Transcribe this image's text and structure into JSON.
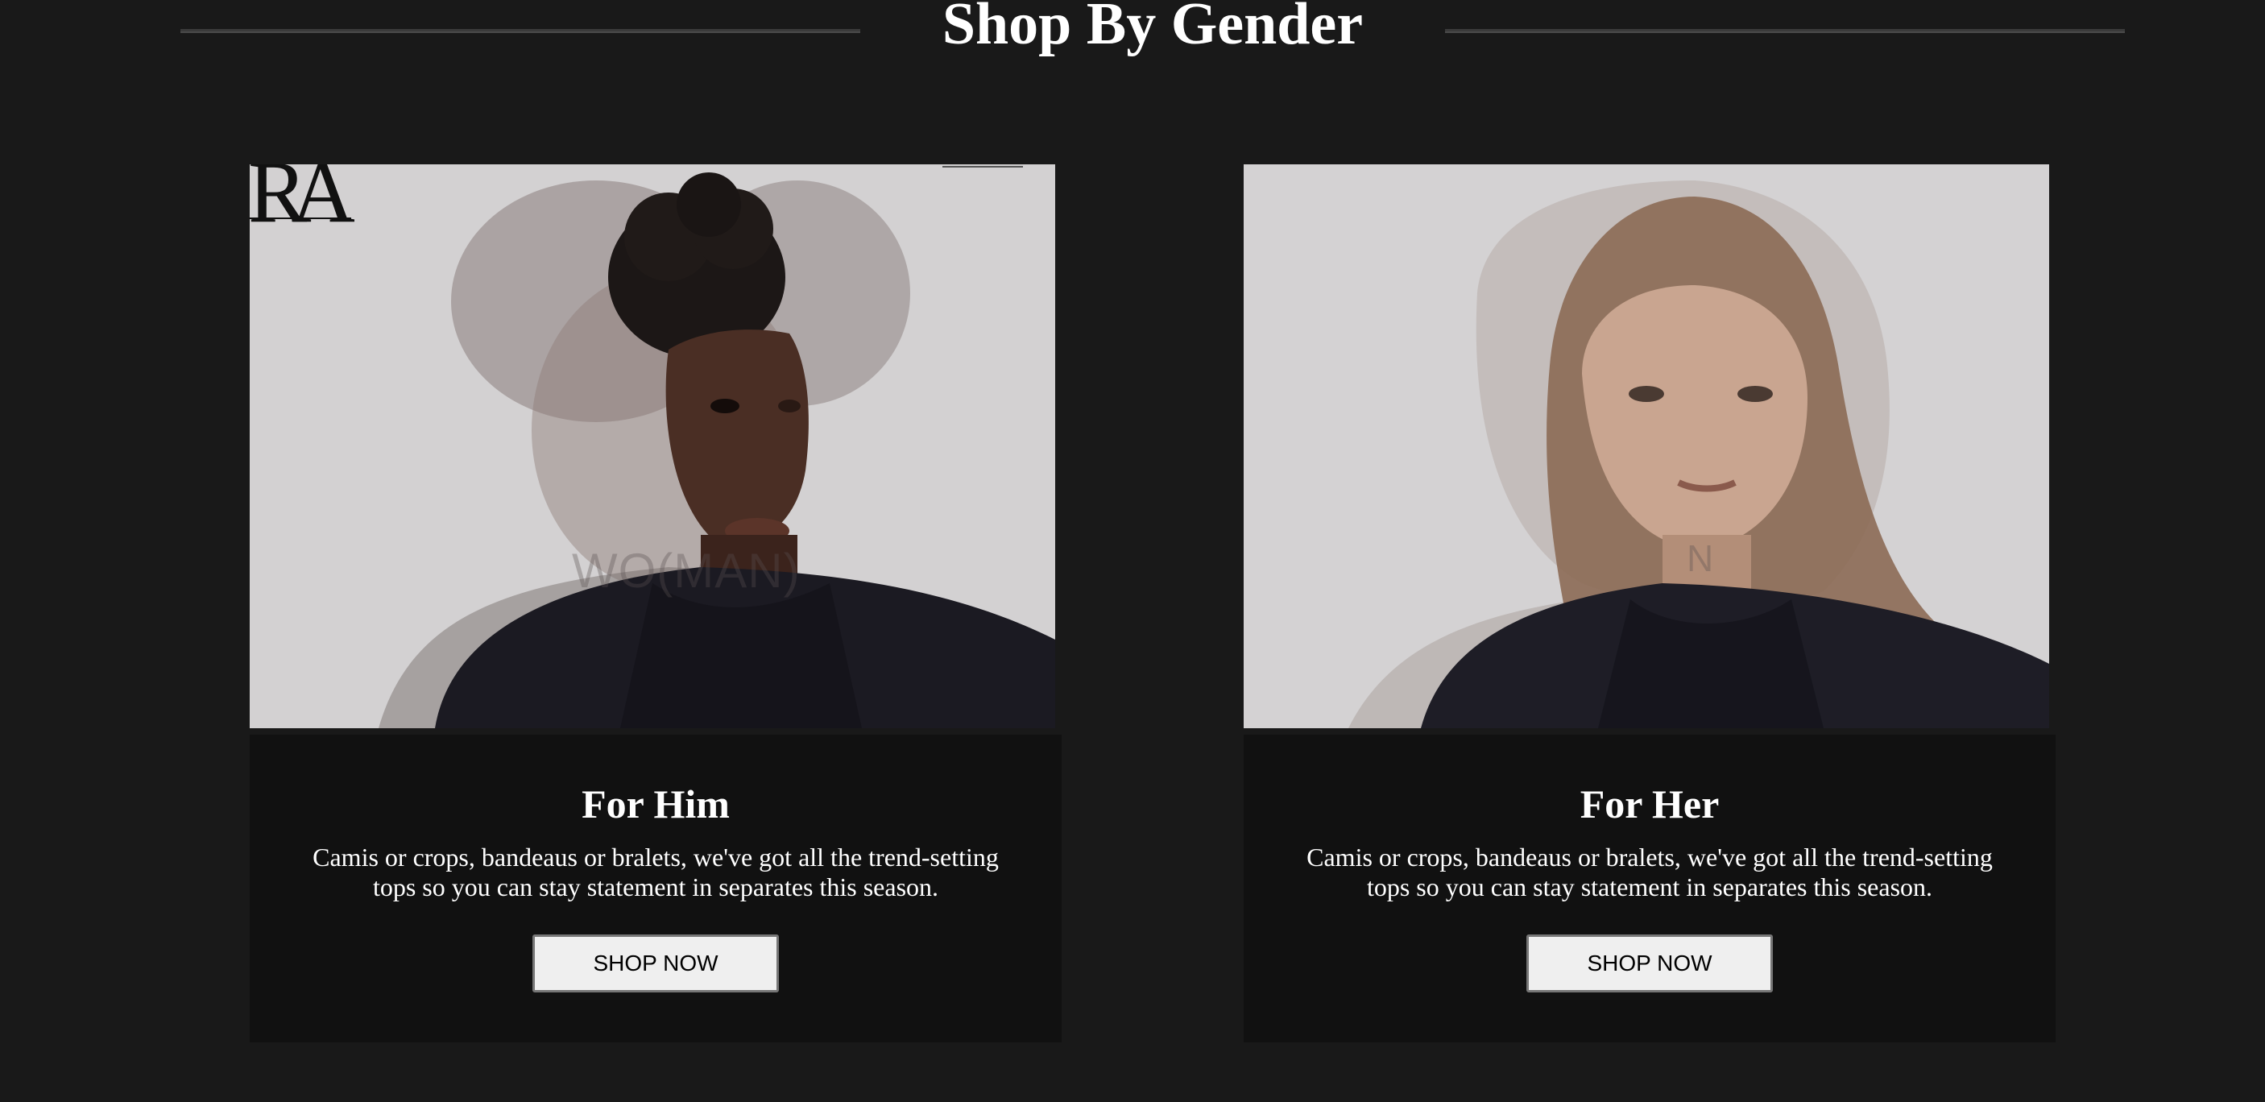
{
  "section": {
    "title": "Shop By Gender"
  },
  "cards": [
    {
      "id": "him",
      "title": "For Him",
      "description": "Camis or crops, bandeaus or bralets, we've got all the trend-setting tops so you can stay statement in separates this season.",
      "button_label": "SHOP NOW",
      "image": {
        "logo_text": "RA",
        "overlay_text": "WO(MAN)"
      }
    },
    {
      "id": "her",
      "title": "For Her",
      "description": "Camis or crops, bandeaus or bralets, we've got all the trend-setting tops so you can stay statement in separates this season.",
      "button_label": "SHOP NOW",
      "image": {
        "overlay_text": "N"
      }
    }
  ],
  "colors": {
    "page_background": "#191919",
    "card_body_background": "#111111",
    "image_background": "#d3d1d2",
    "button_background": "#efefef",
    "text": "#ffffff"
  }
}
